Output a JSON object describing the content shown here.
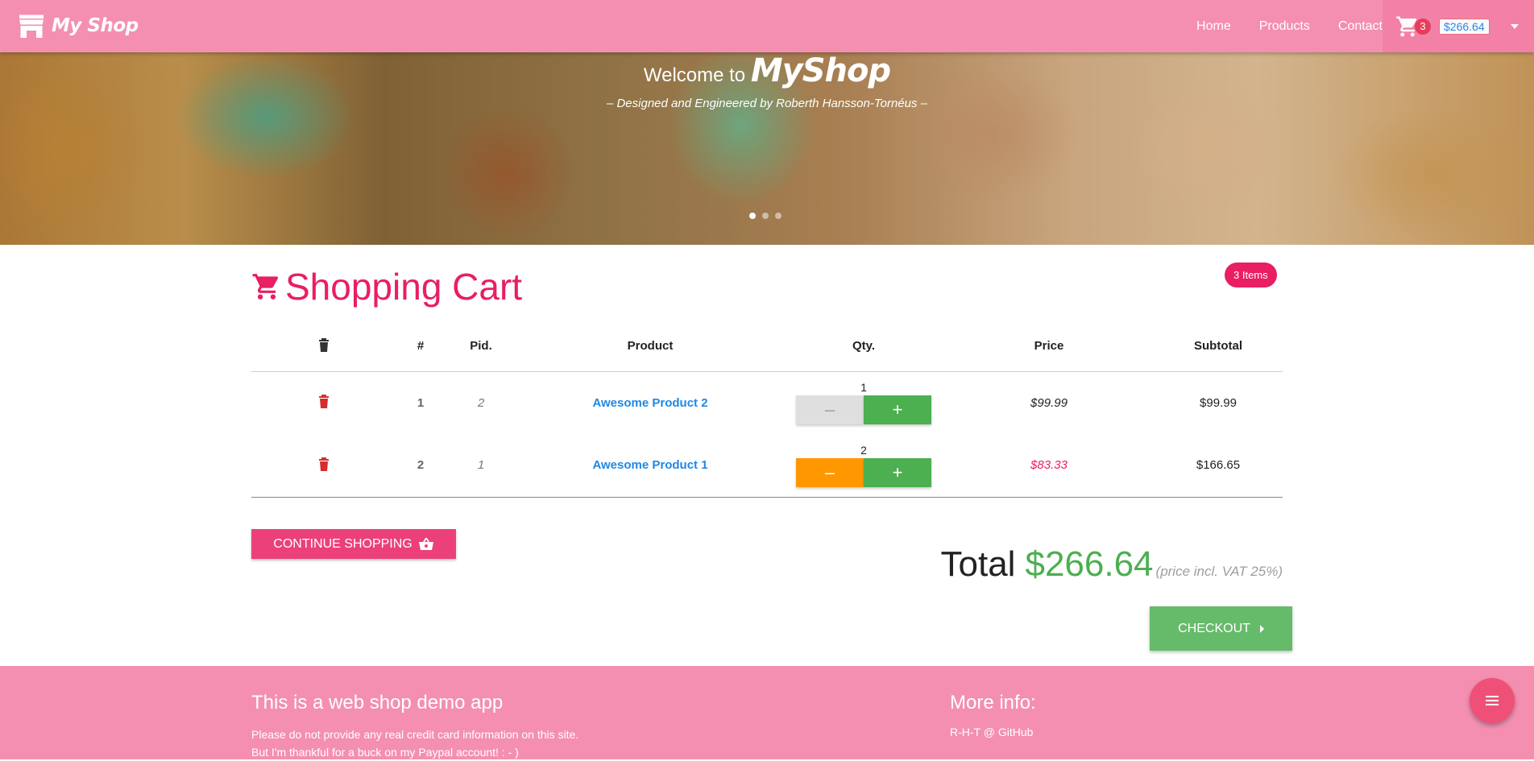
{
  "navbar": {
    "brand": "My Shop",
    "links": [
      "Home",
      "Products",
      "Contact"
    ],
    "cart_count": "3",
    "cart_total": "$266.64"
  },
  "hero": {
    "welcome": "Welcome to",
    "logo_word": "MyShop",
    "subtitle": "– Designed and Engineered by Roberth Hansson-Tornéus –",
    "slide_count": 3,
    "active_slide": 1
  },
  "cart": {
    "title": "Shopping Cart",
    "items_badge": "3 Items",
    "headers": {
      "trash": "trash-icon",
      "num": "#",
      "pid": "Pid.",
      "product": "Product",
      "qty": "Qty.",
      "price": "Price",
      "subtotal": "Subtotal"
    },
    "rows": [
      {
        "num": "1",
        "pid": "2",
        "product": "Awesome Product 2",
        "qty": "1",
        "price": "$99.99",
        "subtotal": "$99.99"
      },
      {
        "num": "2",
        "pid": "1",
        "product": "Awesome Product 1",
        "qty": "2",
        "price": "$83.33",
        "subtotal": "$166.65"
      }
    ],
    "continue_label": "CONTINUE SHOPPING",
    "total_label": "Total",
    "total_amount": "$266.64",
    "vat_note": "(price incl. VAT 25%)",
    "checkout_label": "CHECKOUT"
  },
  "footer": {
    "left_title": "This is a web shop demo app",
    "left_line1": "Please do not provide any real credit card information on this site.",
    "left_line2": "But I'm thankful for a buck on my Paypal account! : - )",
    "right_title": "More info:",
    "right_link": "R-H-T @ GitHub"
  },
  "colors": {
    "navbar": "#f48fb1",
    "accent": "#e91e63",
    "link": "#1e88e5",
    "success": "#4caf50",
    "warning": "#ff9800"
  }
}
